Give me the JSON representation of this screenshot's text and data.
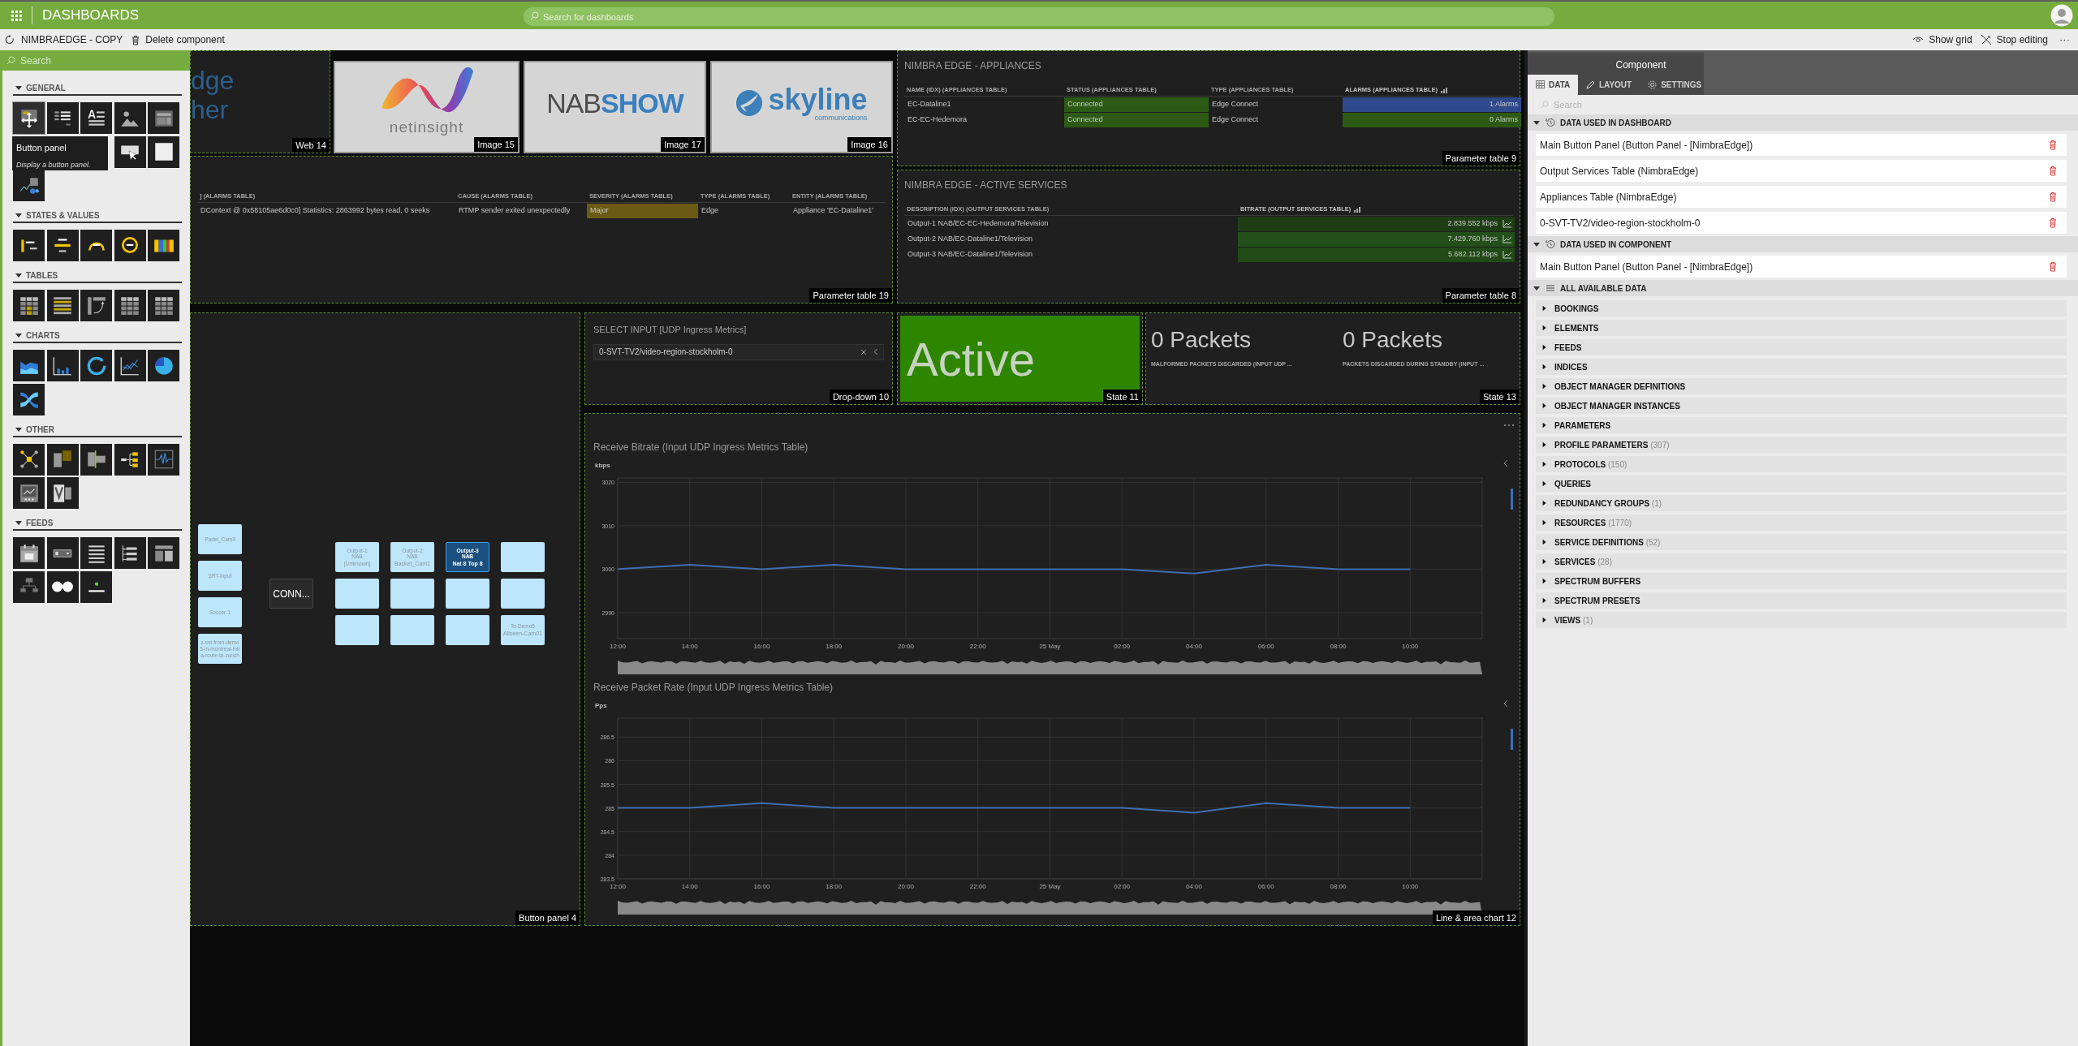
{
  "top_bar": {
    "title": "DASHBOARDS",
    "search": {
      "placeholder": "Search for dashboards"
    }
  },
  "toolbar": {
    "left": [
      {
        "kind": "refresh",
        "label": "NIMBRAEDGE - COPY"
      },
      {
        "kind": "delete",
        "label": "Delete component"
      }
    ],
    "right": [
      {
        "kind": "grid",
        "label": "Show grid"
      },
      {
        "kind": "stop",
        "label": "Stop editing"
      },
      {
        "kind": "more",
        "label": "···"
      }
    ]
  },
  "component_panel": {
    "search": {
      "placeholder": "Search"
    },
    "sections": [
      {
        "title": "GENERAL",
        "expanded": true,
        "tooltip": {
          "title": "Button panel",
          "text": "Display a button panel."
        },
        "tiles": [
          {
            "kind": "button-panel",
            "hovered": true
          },
          {
            "kind": "list",
            "hovered": false
          },
          {
            "kind": "text",
            "hovered": false
          },
          {
            "kind": "image",
            "hovered": false
          },
          {
            "kind": "web",
            "hovered": false
          },
          {
            "kind": "pointer",
            "hovered": false
          },
          {
            "kind": "blank",
            "hovered": false
          },
          {
            "kind": "group",
            "hovered": false
          }
        ]
      },
      {
        "title": "STATES & VALUES",
        "expanded": true,
        "tiles": [
          {
            "kind": "state",
            "hovered": false
          },
          {
            "kind": "value-bar",
            "hovered": false
          },
          {
            "kind": "gauge",
            "hovered": false
          },
          {
            "kind": "ring-gauge",
            "hovered": false
          },
          {
            "kind": "color-bar",
            "hovered": false
          }
        ]
      },
      {
        "title": "TABLES",
        "expanded": true,
        "tiles": [
          {
            "kind": "table",
            "hovered": false
          },
          {
            "kind": "table-lines",
            "hovered": false
          },
          {
            "kind": "table-arrow",
            "hovered": false
          },
          {
            "kind": "grid-table",
            "hovered": false
          },
          {
            "kind": "grid-table",
            "hovered": false
          }
        ]
      },
      {
        "title": "CHARTS",
        "expanded": true,
        "tiles": [
          {
            "kind": "area-chart",
            "hovered": false
          },
          {
            "kind": "bar-chart",
            "hovered": false
          },
          {
            "kind": "donut",
            "hovered": false
          },
          {
            "kind": "line-chart",
            "hovered": false
          },
          {
            "kind": "pie-chart",
            "hovered": false
          },
          {
            "kind": "sankey",
            "hovered": false
          }
        ]
      },
      {
        "title": "OTHER",
        "expanded": true,
        "tiles": [
          {
            "kind": "node-graph",
            "hovered": false
          },
          {
            "kind": "blocks",
            "hovered": false
          },
          {
            "kind": "timeline",
            "hovered": false
          },
          {
            "kind": "tree",
            "hovered": false
          },
          {
            "kind": "spectrum",
            "hovered": false
          },
          {
            "kind": "trend",
            "hovered": false
          },
          {
            "kind": "visual",
            "hovered": false
          }
        ]
      },
      {
        "title": "FEEDS",
        "expanded": true,
        "tiles": [
          {
            "kind": "calendar",
            "hovered": false
          },
          {
            "kind": "dropdown",
            "hovered": false
          },
          {
            "kind": "list-lines",
            "hovered": false
          },
          {
            "kind": "tree-list",
            "hovered": false
          },
          {
            "kind": "layout",
            "hovered": false
          },
          {
            "kind": "hierarchy",
            "hovered": false
          },
          {
            "kind": "slider",
            "hovered": false
          },
          {
            "kind": "dot",
            "hovered": false
          }
        ]
      }
    ]
  },
  "canvas": {
    "components": [
      {
        "kind": "web",
        "label": "Web 14",
        "lines": [
          "dge",
          "her"
        ]
      },
      {
        "kind": "image",
        "label": "Image 15",
        "logo": {
          "kind": "wave",
          "texts": [
            "netinsight"
          ]
        }
      },
      {
        "kind": "image",
        "label": "Image 17",
        "logo": {
          "kind": "nab",
          "texts": [
            "NAB",
            "SHOW"
          ]
        }
      },
      {
        "kind": "image",
        "label": "Image 16",
        "logo": {
          "kind": "bird",
          "texts": [
            "skyline",
            "communications"
          ]
        }
      },
      {
        "kind": "table",
        "label": "Parameter table 19",
        "columns": [
          {
            "text": "] (ALARMS TABLE)",
            "sorted": false
          },
          {
            "text": "CAUSE (ALARMS TABLE)",
            "sorted": false
          },
          {
            "text": "SEVERITY (ALARMS TABLE)",
            "sorted": false
          },
          {
            "text": "TYPE (ALARMS TABLE)",
            "sorted": false
          },
          {
            "text": "ENTITY (ALARMS TABLE)",
            "sorted": false
          }
        ],
        "rows": [
          [
            "DContext @ 0x58105ae6d0c0] Statistics: 2863992 bytes read, 0 seeks",
            "RTMP sender exited unexpectedly",
            {
              "text": "Major",
              "color": "#6b5a14"
            },
            "Edge",
            "Appliance 'EC-Dataline1'"
          ]
        ]
      },
      {
        "kind": "table",
        "label": "Parameter table 9",
        "title": "NIMBRA EDGE - APPLIANCES",
        "columns": [
          {
            "text": "NAME (IDX) (APPLIANCES TABLE)",
            "sorted": false
          },
          {
            "text": "STATUS (APPLIANCES TABLE)",
            "sorted": false
          },
          {
            "text": "TYPE (APPLIANCES TABLE)",
            "sorted": false
          },
          {
            "text": "ALARMS (APPLIANCES TABLE)",
            "sorted": true
          }
        ],
        "rows": [
          [
            "EC-Dataline1",
            {
              "text": "Connected",
              "color": "#2c5a14"
            },
            "Edge Connect",
            {
              "text": "1 Alarms",
              "color": "#2f4a8a"
            }
          ],
          [
            "EC-EC-Hedemora",
            {
              "text": "Connected",
              "color": "#2c5a14"
            },
            "Edge Connect",
            {
              "text": "0 Alarms",
              "color": "#2c5a14"
            }
          ]
        ]
      },
      {
        "kind": "table",
        "label": "Parameter table 8",
        "title": "NIMBRA EDGE - ACTIVE SERVICES",
        "columns": [
          {
            "text": "DESCRIPTION (IDX) (OUTPUT SERVICES TABLE)",
            "sorted": false
          },
          {
            "text": "BITRATE (OUTPUT SERVICES TABLE)",
            "sorted": true
          }
        ],
        "rows": [
          [
            "Output-1 NAB/EC-EC-Hedemora/Television",
            {
              "text": "2.839.552 kbps",
              "color": "#1e3d14",
              "trend": true
            }
          ],
          [
            "Output-2 NAB/EC-Dataline1/Television",
            {
              "text": "7.429.760 kbps",
              "color": "#23501a",
              "trend": true
            }
          ],
          [
            "Output-3 NAB/EC-Dataline1/Television",
            {
              "text": "5.682.112 kbps",
              "color": "#214a17",
              "trend": true
            }
          ]
        ]
      },
      {
        "kind": "button_panel",
        "label": "Button panel 4",
        "inputs": [
          {
            "text": "Padel_Cam3"
          },
          {
            "text": "SRT-input"
          },
          {
            "text": "Soccer-1"
          },
          {
            "text": "z-svt-from-demo5-in-montreal-intra-route-to-zurich"
          }
        ],
        "connect": {
          "text": "CONN..."
        },
        "outputs": [
          {
            "title": [
              "Output-1",
              "NAB"
            ],
            "sub": "[Unknown]",
            "selected": false
          },
          {
            "title": [
              "Output-2",
              "NAB"
            ],
            "sub": "Basket_Cam1",
            "selected": false
          },
          {
            "title": [
              "Output-3",
              "NAB"
            ],
            "sub": "Nat 8 Top 8",
            "selected": true
          },
          {
            "selected": false
          },
          {
            "selected": false
          },
          {
            "selected": false
          },
          {
            "selected": false
          },
          {
            "selected": false
          },
          {
            "selected": false
          },
          {
            "selected": false
          },
          {
            "selected": false
          },
          {
            "title": [
              "To-Demo5"
            ],
            "sub": "Allseen-Cam01",
            "selected": false
          }
        ]
      },
      {
        "kind": "dropdown",
        "label": "Drop-down 10",
        "title": "SELECT INPUT [UDP Ingress Metrics]",
        "value": "0-SVT-TV2/video-region-stockholm-0"
      },
      {
        "kind": "state",
        "label": "State 11",
        "items": [
          {
            "value": "Active",
            "color": "#2e8500"
          }
        ]
      },
      {
        "kind": "state",
        "label": "State 13",
        "items": [
          {
            "value": "0 Packets",
            "caption": "MALFORMED PACKETS DISCARDED (INPUT UDP ..."
          },
          {
            "value": "0 Packets",
            "caption": "PACKETS DISCARDED DURING STANDBY (INPUT ..."
          }
        ]
      },
      {
        "kind": "charts",
        "label": "Line & area chart 12",
        "charts": [
          {
            "title": "Receive Bitrate (Input UDP Ingress Metrics Table)",
            "unit": "kbps",
            "chart_data": {
              "type": "line",
              "grid": true,
              "x": [
                "12:00",
                "14:00",
                "16:00",
                "18:00",
                "20:00",
                "22:00",
                "25 May",
                "02:00",
                "04:00",
                "06:00",
                "08:00",
                "10:00"
              ],
              "series": [
                {
                  "color": "#3d6fb0",
                  "values": [
                    3000,
                    3001,
                    3000,
                    3001,
                    3000,
                    3000,
                    3000,
                    3000,
                    2999,
                    3001,
                    3000,
                    3000
                  ]
                }
              ],
              "ylim": [
                2984,
                3021
              ],
              "yticks": [
                2990,
                3000,
                3010,
                3020
              ]
            }
          },
          {
            "title": "Receive Packet Rate (Input UDP Ingress Metrics Table)",
            "unit": "Pps",
            "chart_data": {
              "type": "line",
              "grid": true,
              "x": [
                "12:00",
                "14:00",
                "16:00",
                "18:00",
                "20:00",
                "22:00",
                "25 May",
                "02:00",
                "04:00",
                "06:00",
                "08:00",
                "10:00"
              ],
              "series": [
                {
                  "color": "#3d6fb0",
                  "values": [
                    285,
                    285,
                    285.1,
                    285,
                    285,
                    285,
                    285,
                    285,
                    284.9,
                    285.1,
                    285,
                    285
                  ]
                }
              ],
              "ylim": [
                283.5,
                286.9
              ],
              "yticks": [
                283.5,
                284,
                284.5,
                285,
                285.5,
                286,
                286.5
              ]
            }
          }
        ]
      }
    ]
  },
  "side_panel": {
    "group": "Component",
    "tabs": [
      {
        "label": "DATA",
        "kind": "table",
        "selected": true
      },
      {
        "label": "LAYOUT",
        "kind": "pencil",
        "selected": false
      },
      {
        "label": "SETTINGS",
        "kind": "gear",
        "selected": false
      }
    ],
    "search": {
      "placeholder": "Search"
    },
    "sections": [
      {
        "title": "DATA USED IN DASHBOARD",
        "kind": "history",
        "expanded": true,
        "items": [
          {
            "label": "Main Button Panel (Button Panel - [NimbraEdge])"
          },
          {
            "label": "Output Services Table (NimbraEdge)"
          },
          {
            "label": "Appliances Table (NimbraEdge)"
          },
          {
            "label": "0-SVT-TV2/video-region-stockholm-0"
          }
        ]
      },
      {
        "title": "DATA USED IN COMPONENT",
        "kind": "history",
        "expanded": true,
        "items": [
          {
            "label": "Main Button Panel (Button Panel - [NimbraEdge])"
          }
        ]
      },
      {
        "title": "ALL AVAILABLE DATA",
        "kind": "list",
        "expanded": true,
        "categories": [
          {
            "label": "BOOKINGS",
            "expanded": false
          },
          {
            "label": "ELEMENTS",
            "expanded": false
          },
          {
            "label": "FEEDS",
            "expanded": false
          },
          {
            "label": "INDICES",
            "expanded": false
          },
          {
            "label": "OBJECT MANAGER DEFINITIONS",
            "expanded": false
          },
          {
            "label": "OBJECT MANAGER INSTANCES",
            "expanded": false
          },
          {
            "label": "PARAMETERS",
            "expanded": false
          },
          {
            "label": "PROFILE PARAMETERS",
            "count": "(307)",
            "expanded": false
          },
          {
            "label": "PROTOCOLS",
            "count": "(150)",
            "expanded": false
          },
          {
            "label": "QUERIES",
            "expanded": false
          },
          {
            "label": "REDUNDANCY GROUPS",
            "count": "(1)",
            "expanded": false
          },
          {
            "label": "RESOURCES",
            "count": "(1770)",
            "expanded": false
          },
          {
            "label": "SERVICE DEFINITIONS",
            "count": "(52)",
            "expanded": false
          },
          {
            "label": "SERVICES",
            "count": "(28)",
            "expanded": false
          },
          {
            "label": "SPECTRUM BUFFERS",
            "expanded": false
          },
          {
            "label": "SPECTRUM PRESETS",
            "expanded": false
          },
          {
            "label": "VIEWS",
            "count": "(1)",
            "expanded": false
          }
        ]
      }
    ]
  }
}
